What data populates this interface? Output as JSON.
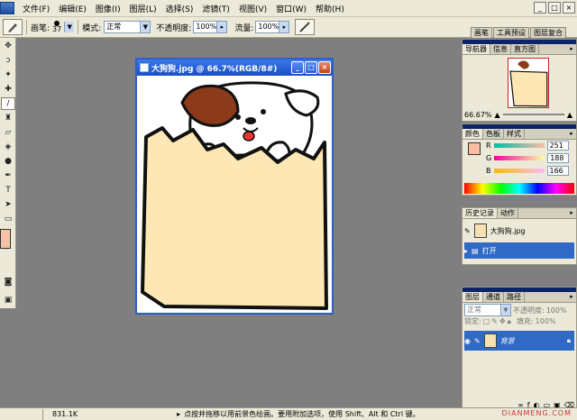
{
  "menubar": {
    "items": [
      "文件(F)",
      "编辑(E)",
      "图像(I)",
      "图层(L)",
      "选择(S)",
      "滤镜(T)",
      "视图(V)",
      "窗口(W)",
      "帮助(H)"
    ]
  },
  "options": {
    "brush_label": "画笔:",
    "brush_size": "37",
    "mode_label": "模式:",
    "mode_value": "正常",
    "opacity_label": "不透明度:",
    "opacity_value": "100%",
    "flow_label": "流量:",
    "flow_value": "100%",
    "well_tabs": [
      "画笔",
      "工具预设",
      "图层复合"
    ]
  },
  "document": {
    "title": "大狗狗.jpg @ 66.7%(RGB/8#)"
  },
  "navigator": {
    "tabs": [
      "导航器",
      "信息",
      "直方图"
    ],
    "zoom": "66.67%"
  },
  "color": {
    "tabs": [
      "颜色",
      "色板",
      "样式"
    ],
    "channels": [
      {
        "name": "R",
        "value": "251"
      },
      {
        "name": "G",
        "value": "188"
      },
      {
        "name": "B",
        "value": "166"
      }
    ]
  },
  "history": {
    "tabs": [
      "历史记录",
      "动作"
    ],
    "snapshot": "大狗狗.jpg",
    "step": "打开"
  },
  "layers": {
    "tabs": [
      "图层",
      "通道",
      "路径"
    ],
    "blend_mode": "正常",
    "opacity_label": "不透明度:",
    "opacity_value": "100%",
    "lock_label": "锁定:",
    "fill_label": "填充:",
    "fill_value": "100%",
    "layer_name": "背景"
  },
  "status": {
    "doc_size": "831.1K",
    "hint": "点按并拖移以用前景色绘画。要用附加选项，使用 Shift、Alt 和 Ctrl 键。",
    "watermark": "DIANMENG.COM"
  },
  "colors": {
    "accent": "#316ac5",
    "foreground": "#fbbca6",
    "bag": "#fde7b5"
  }
}
